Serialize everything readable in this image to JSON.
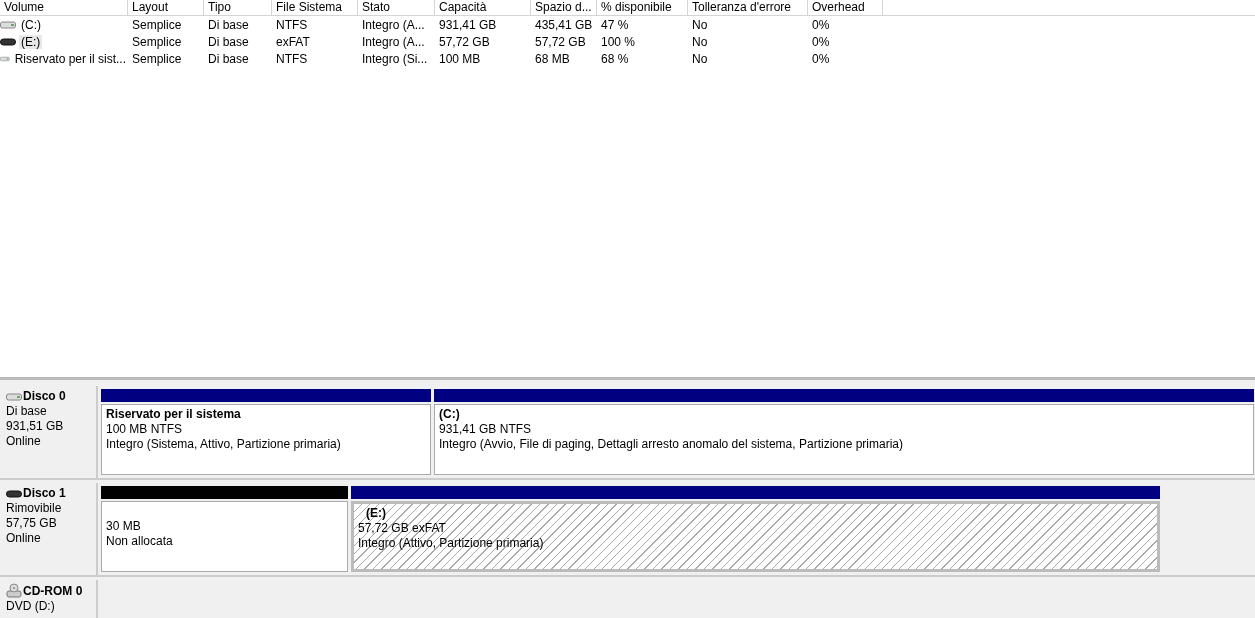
{
  "volume_table": {
    "columns": [
      "Volume",
      "Layout",
      "Tipo",
      "File Sistema",
      "Stato",
      "Capacità",
      "Spazio d...",
      "% disponibile",
      "Tolleranza d'errore",
      "Overhead"
    ],
    "rows": [
      {
        "kind": "hdd",
        "selected": false,
        "cells": [
          "(C:)",
          "Semplice",
          "Di base",
          "NTFS",
          "Integro (A...",
          "931,41 GB",
          "435,41 GB",
          "47 %",
          "No",
          "0%"
        ]
      },
      {
        "kind": "removable",
        "selected": true,
        "cells": [
          "(E:)",
          "Semplice",
          "Di base",
          "exFAT",
          "Integro (A...",
          "57,72 GB",
          "57,72 GB",
          "100 %",
          "No",
          "0%"
        ]
      },
      {
        "kind": "hdd",
        "selected": false,
        "cells": [
          "Riservato per il sist...",
          "Semplice",
          "Di base",
          "NTFS",
          "Integro (Si...",
          "100 MB",
          "68 MB",
          "68 %",
          "No",
          "0%"
        ]
      }
    ]
  },
  "disks": [
    {
      "kind": "hdd",
      "name": "Disco 0",
      "type": "Di base",
      "size": "931,51 GB",
      "status": "Online",
      "partitions": [
        {
          "kind": "primary",
          "selected": false,
          "title": "Riservato per il sistema",
          "size": "100 MB NTFS",
          "status": "Integro (Sistema, Attivo, Partizione primaria)"
        },
        {
          "kind": "primary",
          "selected": false,
          "title": "(C:)",
          "size": "931,41 GB NTFS",
          "status": "Integro (Avvio, File di paging, Dettagli arresto anomalo del sistema, Partizione primaria)"
        }
      ]
    },
    {
      "kind": "removable",
      "name": "Disco 1",
      "type": "Rimovibile",
      "size": "57,75 GB",
      "status": "Online",
      "partitions": [
        {
          "kind": "unallocated",
          "selected": false,
          "size": "30 MB",
          "status": "Non allocata"
        },
        {
          "kind": "primary",
          "selected": true,
          "title": "(E:)",
          "size": "57,72 GB exFAT",
          "status": "Integro (Attivo, Partizione primaria)"
        }
      ]
    },
    {
      "kind": "cdrom",
      "name": "CD-ROM 0",
      "type": "DVD (D:)"
    }
  ]
}
